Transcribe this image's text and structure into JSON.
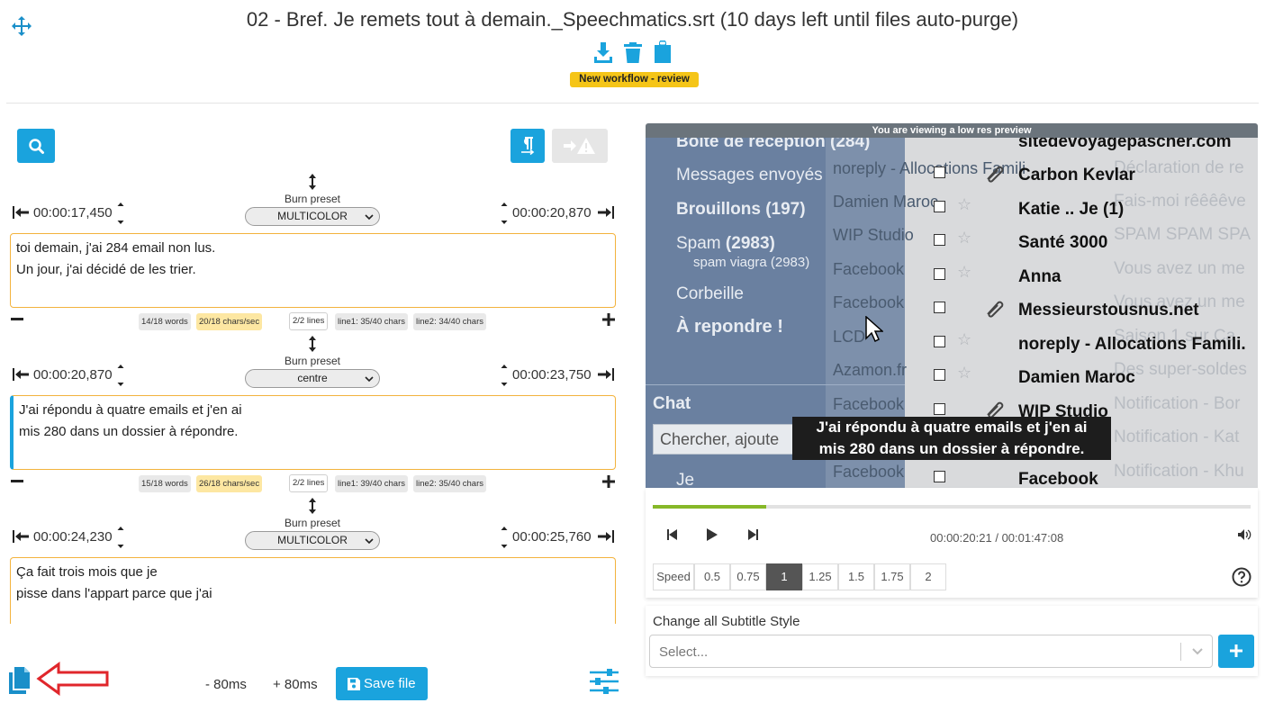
{
  "header": {
    "title": "02 - Bref. Je remets tout à demain._Speechmatics.srt (10 days left until files auto-purge)",
    "workflow_badge": "New workflow - review",
    "icons": [
      "move-icon",
      "download-icon",
      "trash-icon",
      "clipboard-icon"
    ]
  },
  "toolbar": {
    "icons": [
      "search-icon",
      "paragraph-icon",
      "arrow-warning-icon"
    ]
  },
  "subtitles": [
    {
      "preset_label": "Burn preset",
      "preset": "MULTICOLOR",
      "start": "00:00:17,450",
      "end": "00:00:20,870",
      "lines": [
        "toi demain, j'ai 284 email non lus.",
        "Un jour, j'ai décidé de les trier."
      ],
      "stats": {
        "words": "14/18 words",
        "cps": "20/18 chars/sec",
        "lines": "2/2 lines",
        "line1": "line1: 35/40 chars",
        "line2": "line2: 34/40 chars"
      }
    },
    {
      "preset_label": "Burn preset",
      "preset": "centre",
      "start": "00:00:20,870",
      "end": "00:00:23,750",
      "lines": [
        "J'ai répondu à quatre emails et j'en ai",
        "mis 280 dans un dossier à répondre."
      ],
      "stats": {
        "words": "15/18 words",
        "cps": "26/18 chars/sec",
        "lines": "2/2 lines",
        "line1": "line1: 39/40 chars",
        "line2": "line2: 35/40 chars"
      }
    },
    {
      "preset_label": "Burn preset",
      "preset": "MULTICOLOR",
      "start": "00:00:24,230",
      "end": "00:00:25,760",
      "lines": [
        "Ça fait trois mois que je",
        "pisse dans l'appart parce que j'ai"
      ]
    }
  ],
  "bottom": {
    "minus_shift": "- 80ms",
    "plus_shift": "+ 80ms",
    "save_label": "Save file"
  },
  "video": {
    "preview_banner": "You are viewing a low res preview",
    "caption": [
      "J'ai répondu à quatre emails et j'en ai",
      "mis 280 dans un dossier à répondre."
    ],
    "nav": {
      "top_cut": "Boîte de réception (284)",
      "sent": "Messages envoyés",
      "drafts": "Brouillons (197)",
      "spam": "Spam",
      "spam_count": "(2983)",
      "spam_sub": "spam viagra (2983)",
      "trash": "Corbeille",
      "reply": "À repondre !",
      "chat": "Chat",
      "chat_search": "Chercher, ajoute",
      "je": "Je"
    },
    "senders_mid": [
      "noreply - Allocations Famili",
      "Damien Maroc",
      "WIP Studio",
      "Facebook",
      "Facebook",
      "LCD",
      "Azamon.fr",
      "Facebook",
      "Facebook"
    ],
    "senders_right": [
      "sitedevoyagepascher.com",
      "Carbon Kevlar",
      "Katie .. Je (1)",
      "Santé 3000",
      "Anna",
      "Messieurstousnus.net",
      "noreply - Allocations Famili.",
      "Damien Maroc",
      "WIP Studio",
      "Facebook"
    ],
    "ghost_subjects": [
      "Déclaration de re",
      "Fais-moi rêêêêve",
      "SPAM SPAM SPA",
      "Vous avez un me",
      "Vous avez un me",
      "Saison 1 sur Ca",
      "Des super-soldes",
      "Notification - Bor",
      "Notification - Kat",
      "Notification - Khu"
    ]
  },
  "player": {
    "progress": 0.19,
    "current_time": "00:00:20:21",
    "duration": "00:01:47:08",
    "time_separator": "/",
    "speed_label": "Speed",
    "speeds": [
      "0.5",
      "0.75",
      "1",
      "1.25",
      "1.5",
      "1.75",
      "2"
    ],
    "selected_speed": "1"
  },
  "style_changer": {
    "label": "Change all Subtitle Style",
    "placeholder": "Select..."
  },
  "colors": {
    "accent": "#1aa3dd",
    "warning": "#f5c518",
    "textbox_border": "#f3b33d",
    "progress": "#86b828"
  }
}
